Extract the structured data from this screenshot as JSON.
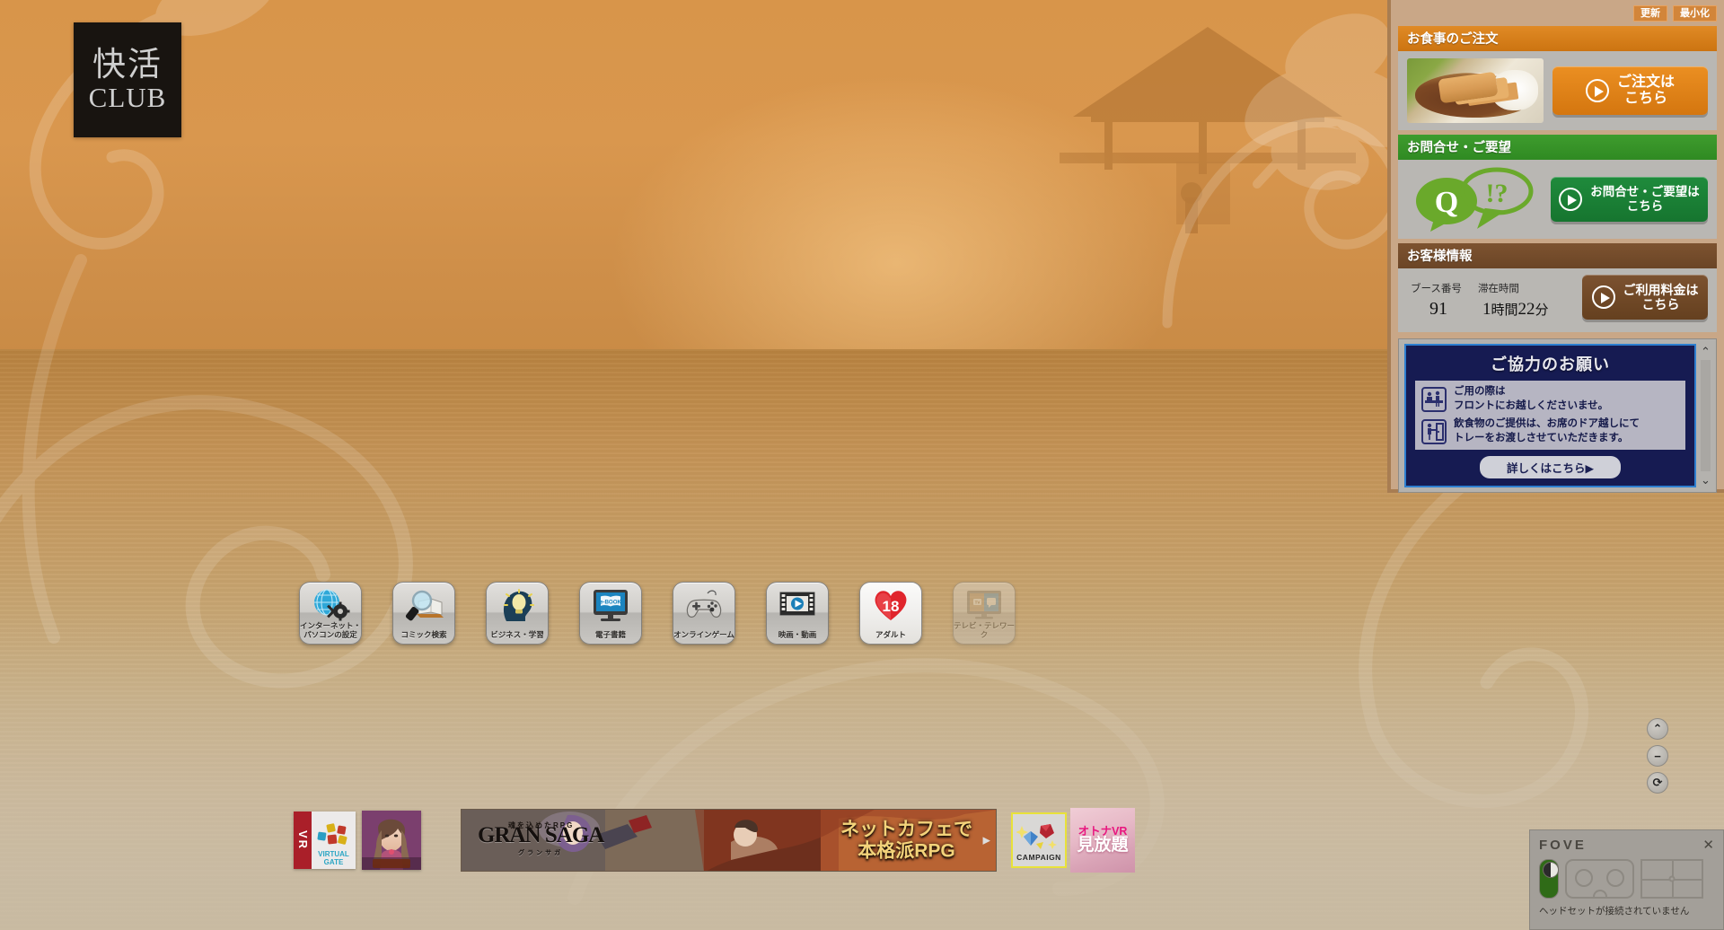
{
  "logo": {
    "jp": "快活",
    "en": "CLUB"
  },
  "window_buttons": {
    "refresh": "更新",
    "minimize": "最小化"
  },
  "right_panel": {
    "food": {
      "title": "お食事のご注文",
      "cta_line1": "ご注文は",
      "cta_line2": "こちら",
      "image_name": "katsu-curry-photo"
    },
    "inquiry": {
      "title": "お問合せ・ご要望",
      "cta_line1": "お問合せ・ご要望は",
      "cta_line2": "こちら",
      "icon_q": "Q",
      "icon_mark": "!?"
    },
    "customer": {
      "title": "お客様情報",
      "booth_label": "ブース番号",
      "booth_value": "91",
      "stay_label": "滞在時間",
      "stay_hours": "1",
      "stay_hours_unit": "時間",
      "stay_minutes": "22",
      "stay_minutes_unit": "分",
      "cta_line1": "ご利用料金は",
      "cta_line2": "こちら"
    },
    "notice": {
      "title": "ご協力のお願い",
      "items": [
        {
          "line1": "ご用の際は",
          "line2": "フロントにお越しくださいませ。",
          "icon": "front-desk-pictogram"
        },
        {
          "line1": "飲食物のご提供は、お席のドア越しにて",
          "line2": "トレーをお渡しさせていただきます。",
          "icon": "door-tray-pictogram"
        }
      ],
      "detail_button": "詳しくはこちら▶"
    }
  },
  "side_controls": [
    {
      "name": "scroll-up-button",
      "glyph": "⌃"
    },
    {
      "name": "minimize-button",
      "glyph": "−"
    },
    {
      "name": "reload-button",
      "glyph": "⟳"
    }
  ],
  "apps": [
    {
      "id": "internet-settings",
      "label_line1": "インターネット・",
      "label_line2": "パソコンの設定",
      "icon": "globe-gear-icon",
      "style": "normal"
    },
    {
      "id": "comic-search",
      "label_line1": "コミック検索",
      "label_line2": "",
      "icon": "magnifier-book-icon",
      "style": "normal"
    },
    {
      "id": "business-study",
      "label_line1": "ビジネス・学習",
      "label_line2": "",
      "icon": "head-lightbulb-icon",
      "style": "normal"
    },
    {
      "id": "ebook",
      "label_line1": "電子書籍",
      "label_line2": "",
      "icon": "ebook-monitor-icon",
      "style": "normal"
    },
    {
      "id": "online-game",
      "label_line1": "オンラインゲーム",
      "label_line2": "",
      "icon": "gamepad-icon",
      "style": "normal"
    },
    {
      "id": "movie-video",
      "label_line1": "映画・動画",
      "label_line2": "",
      "icon": "film-play-icon",
      "style": "normal"
    },
    {
      "id": "adult",
      "label_line1": "アダルト",
      "label_line2": "",
      "icon": "heart-18-icon",
      "style": "white"
    },
    {
      "id": "tv-telework",
      "label_line1": "テレビ・テレワーク",
      "label_line2": "",
      "icon": "tv-monitor-icon",
      "style": "disabled"
    }
  ],
  "banners": {
    "vr_gate": {
      "vr": "VR",
      "line1": "VIRTUAL",
      "line2": "GATE"
    },
    "game_art": {
      "name": "fantasy-girl-thumbnail"
    },
    "gran_saga": {
      "sup": "魂を込めたRPG",
      "logo": "GRAN SAGA",
      "logo_sub": "グランサガ",
      "right_line1": "ネットカフェで",
      "right_line2": "本格派RPG",
      "arrow": "▶"
    },
    "campaign": {
      "label": "CAMPAIGN"
    },
    "otona_vr": {
      "line1": "オトナVR",
      "line2": "見放題"
    }
  },
  "fove": {
    "brand": "FOVE",
    "close": "✕",
    "status": "ヘッドセットが接続されていません",
    "icons": [
      "battery-icon",
      "headset-icon",
      "tracking-grid-icon"
    ]
  }
}
